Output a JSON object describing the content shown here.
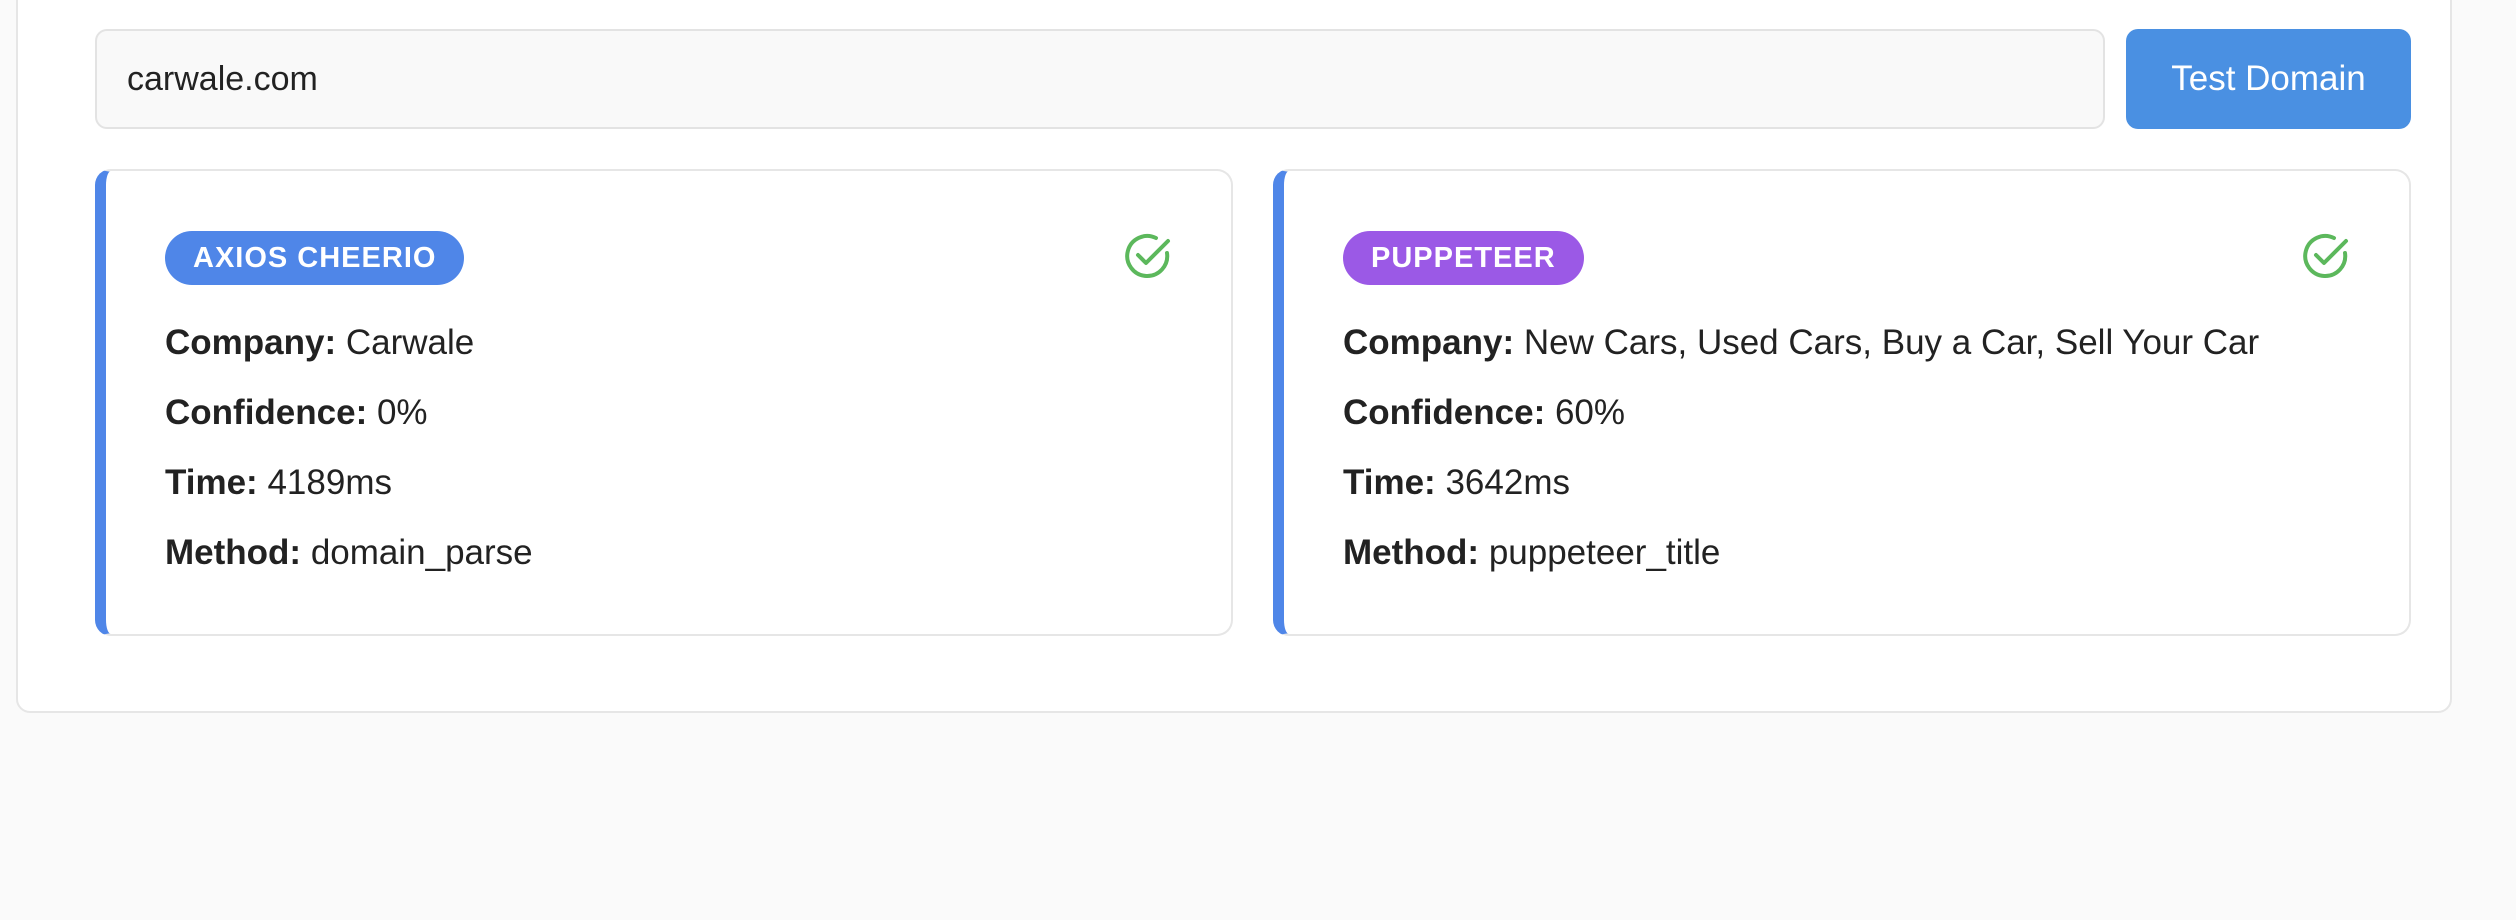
{
  "search": {
    "value": "carwale.com",
    "button_label": "Test Domain"
  },
  "colors": {
    "accent": "#4a90e2",
    "card_border_accent": "#4f86e8",
    "axios_badge": "#4f86e8",
    "puppeteer_badge": "#9b59e6",
    "success_check": "#5cb85c"
  },
  "results": [
    {
      "badge": "AXIOS CHEERIO",
      "status_icon": "check-circle-icon",
      "company_label": "Company:",
      "company": "Carwale",
      "confidence_label": "Confidence:",
      "confidence": "0%",
      "time_label": "Time:",
      "time": "4189ms",
      "method_label": "Method:",
      "method": "domain_parse"
    },
    {
      "badge": "PUPPETEER",
      "status_icon": "check-circle-icon",
      "company_label": "Company:",
      "company": "New Cars, Used Cars, Buy a Car, Sell Your Car",
      "confidence_label": "Confidence:",
      "confidence": "60%",
      "time_label": "Time:",
      "time": "3642ms",
      "method_label": "Method:",
      "method": "puppeteer_title"
    }
  ]
}
